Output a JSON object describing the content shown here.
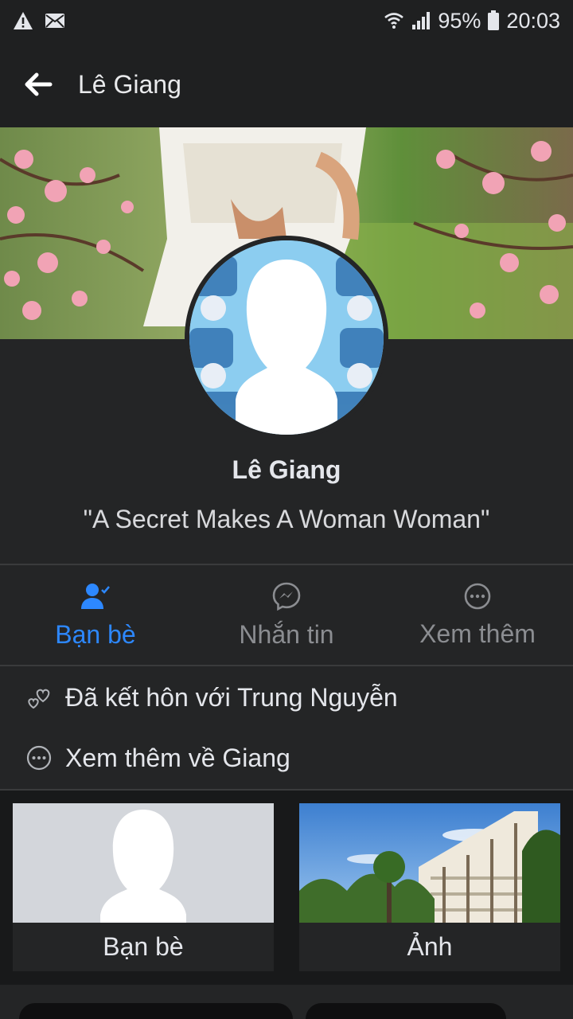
{
  "status_bar": {
    "battery": "95%",
    "time": "20:03",
    "icons": [
      "warning-icon",
      "mail-icon",
      "wifi-icon",
      "signal-icon",
      "battery-icon"
    ]
  },
  "header": {
    "title": "Lê Giang"
  },
  "profile": {
    "name": "Lê Giang",
    "bio": "\"A Secret Makes A Woman Woman\""
  },
  "actions": [
    {
      "label": "Bạn bè",
      "icon": "friends-check-icon",
      "active": true
    },
    {
      "label": "Nhắn tin",
      "icon": "messenger-icon",
      "active": false
    },
    {
      "label": "Xem thêm",
      "icon": "more-icon",
      "active": false
    }
  ],
  "info": [
    {
      "text": "Đã kết hôn với Trung Nguyễn",
      "icon": "hearts-icon"
    },
    {
      "text": "Xem thêm về Giang",
      "icon": "more-icon"
    }
  ],
  "cards": [
    {
      "label": "Bạn bè"
    },
    {
      "label": "Ảnh"
    }
  ],
  "colors": {
    "background": "#242526",
    "accent": "#2d88ff",
    "muted": "#8b8d91"
  }
}
